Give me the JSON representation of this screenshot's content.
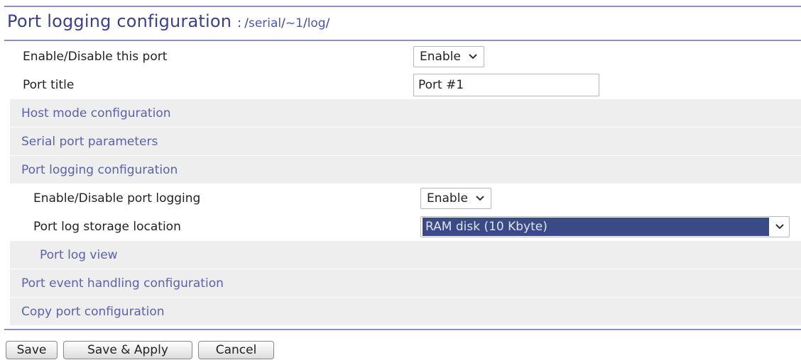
{
  "header": {
    "title": "Port logging configuration",
    "separator": ":",
    "path": [
      {
        "slash": "/",
        "segment": "serial"
      },
      {
        "slash": "/",
        "segment": "~1"
      },
      {
        "slash": "/",
        "segment": "log"
      }
    ],
    "trailing_slash": "/"
  },
  "form": {
    "enable_port": {
      "label": "Enable/Disable this port",
      "value": "Enable"
    },
    "port_title": {
      "label": "Port title",
      "value": "Port #1"
    },
    "nav_host_mode": "Host mode configuration",
    "nav_serial_params": "Serial port parameters",
    "nav_port_logging": "Port logging configuration",
    "enable_logging": {
      "label": "Enable/Disable port logging",
      "value": "Enable"
    },
    "storage_location": {
      "label": "Port log storage location",
      "value": "RAM disk (10 Kbyte)"
    },
    "nav_log_view": "Port log view",
    "nav_event_handling": "Port event handling configuration",
    "nav_copy_port": "Copy port configuration"
  },
  "buttons": {
    "save": "Save",
    "save_apply": "Save & Apply",
    "cancel": "Cancel"
  },
  "icons": {
    "dropdown": "chevron-down-icon"
  },
  "colors": {
    "title": "#3a3f8f",
    "nav_link": "#5a62ad",
    "rule": "#8a8fc0",
    "nav_row_bg": "#eeeeee",
    "selected_option_bg": "#394a86"
  }
}
